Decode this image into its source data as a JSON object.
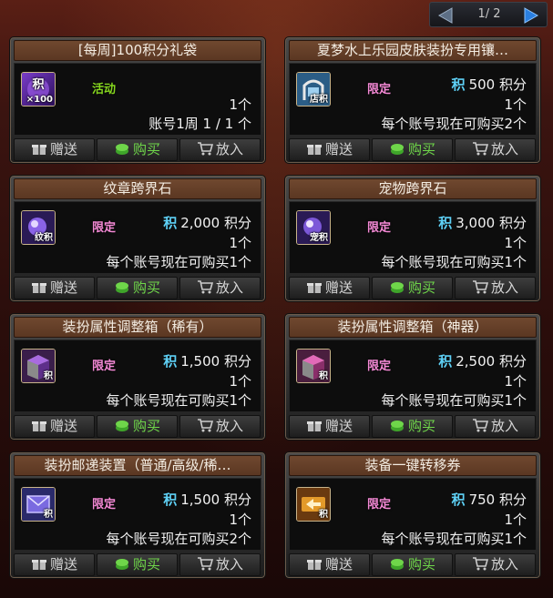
{
  "pager": {
    "text": "1/ 2"
  },
  "colors": {
    "tag_green": "#86d61f",
    "tag_pink": "#f58ad6",
    "points_icon": "#5ed0f5",
    "buy_green": "#6fd64a"
  },
  "buttons": {
    "gift": "赠送",
    "buy": "购买",
    "cart": "放入"
  },
  "points_glyph": "积",
  "items": [
    {
      "title": "[每周]100积分礼袋",
      "tag": "活动",
      "tag_color": "green",
      "icon": "points-bag-icon",
      "icon_label_top": "积",
      "icon_label": "×100",
      "price_line": "",
      "line2": "1个",
      "line3": "账号1周 1 / 1 个"
    },
    {
      "title": "夏梦水上乐园皮肤装扮专用镶…",
      "tag": "限定",
      "tag_color": "pink",
      "icon": "socket-arch-icon",
      "icon_label": "店积",
      "price": "500",
      "unit": "积分",
      "line2": "1个",
      "line3": "每个账号现在可购买2个"
    },
    {
      "title": "纹章跨界石",
      "tag": "限定",
      "tag_color": "pink",
      "icon": "emblem-stone-icon",
      "icon_label": "纹积",
      "price": "2,000",
      "unit": "积分",
      "line2": "1个",
      "line3": "每个账号现在可购买1个"
    },
    {
      "title": "宠物跨界石",
      "tag": "限定",
      "tag_color": "pink",
      "icon": "pet-stone-icon",
      "icon_label": "宠积",
      "price": "3,000",
      "unit": "积分",
      "line2": "1个",
      "line3": "每个账号现在可购买1个"
    },
    {
      "title": "装扮属性调整箱（稀有）",
      "tag": "限定",
      "tag_color": "pink",
      "icon": "rare-box-icon",
      "icon_label": "积",
      "price": "1,500",
      "unit": "积分",
      "line2": "1个",
      "line3": "每个账号现在可购买1个"
    },
    {
      "title": "装扮属性调整箱（神器）",
      "tag": "限定",
      "tag_color": "pink",
      "icon": "artifact-box-icon",
      "icon_label": "积",
      "price": "2,500",
      "unit": "积分",
      "line2": "1个",
      "line3": "每个账号现在可购买1个"
    },
    {
      "title": "装扮邮递装置（普通/高级/稀…",
      "tag": "限定",
      "tag_color": "pink",
      "icon": "mail-device-icon",
      "icon_label": "积",
      "price": "1,500",
      "unit": "积分",
      "line2": "1个",
      "line3": "每个账号现在可购买2个"
    },
    {
      "title": "装备一键转移券",
      "tag": "限定",
      "tag_color": "pink",
      "icon": "transfer-ticket-icon",
      "icon_label": "积",
      "price": "750",
      "unit": "积分",
      "line2": "1个",
      "line3": "每个账号现在可购买1个"
    }
  ]
}
